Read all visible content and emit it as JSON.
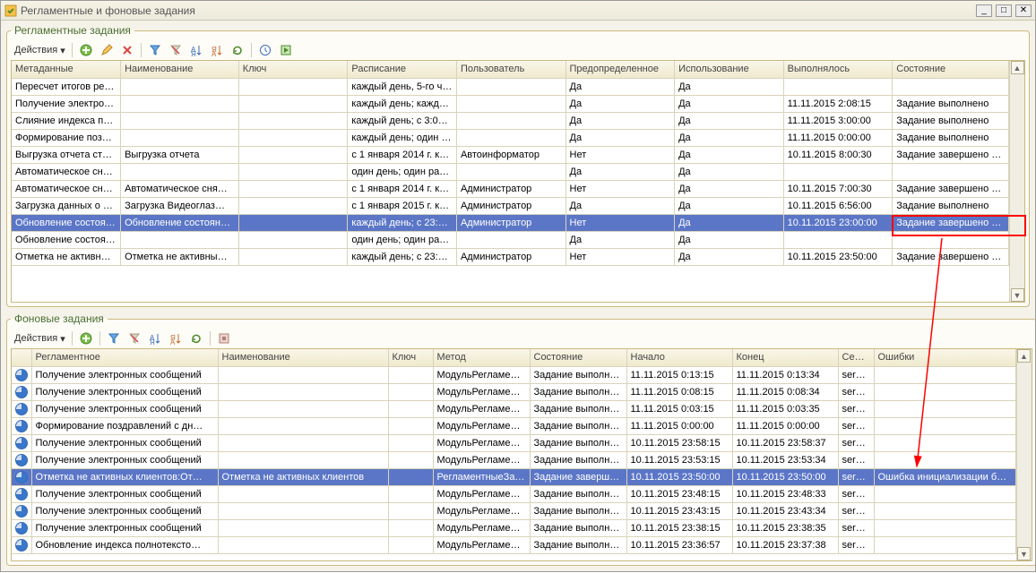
{
  "window": {
    "title": "Регламентные и фоновые задания"
  },
  "panel1": {
    "legend": "Регламентные задания",
    "actions_label": "Действия",
    "columns": [
      "Метаданные",
      "Наименование",
      "Ключ",
      "Расписание",
      "Пользователь",
      "Предопределенное",
      "Использование",
      "Выполнялось",
      "Состояние"
    ],
    "rows": [
      {
        "meta": "Пересчет итогов ре…",
        "name": "",
        "key": "",
        "sched": "каждый  день, 5-го ч…",
        "user": "",
        "pre": "Да",
        "use": "Да",
        "ran": "",
        "state": ""
      },
      {
        "meta": "Получение электро…",
        "name": "",
        "key": "",
        "sched": "каждый  день; кажд…",
        "user": "",
        "pre": "Да",
        "use": "Да",
        "ran": "11.11.2015 2:08:15",
        "state": "Задание выполнено"
      },
      {
        "meta": "Слияние индекса по…",
        "name": "",
        "key": "",
        "sched": "каждый  день; с 3:0…",
        "user": "",
        "pre": "Да",
        "use": "Да",
        "ran": "11.11.2015 3:00:00",
        "state": "Задание выполнено"
      },
      {
        "meta": "Формирование поз…",
        "name": "",
        "key": "",
        "sched": "каждый  день; один …",
        "user": "",
        "pre": "Да",
        "use": "Да",
        "ran": "11.11.2015 0:00:00",
        "state": "Задание выполнено"
      },
      {
        "meta": "Выгрузка отчета ст…",
        "name": "Выгрузка отчета",
        "key": "",
        "sched": "с 1 января 2014 г. к…",
        "user": "Автоинформатор",
        "pre": "Нет",
        "use": "Да",
        "ran": "10.11.2015 8:00:30",
        "state": "Задание завершено …"
      },
      {
        "meta": "Автоматическое сн…",
        "name": "",
        "key": "",
        "sched": "один день; один раз…",
        "user": "",
        "pre": "Да",
        "use": "Да",
        "ran": "",
        "state": ""
      },
      {
        "meta": "Автоматическое сн…",
        "name": "Автоматическое сня…",
        "key": "",
        "sched": "с 1 января 2014 г. к…",
        "user": "Администратор",
        "pre": "Нет",
        "use": "Да",
        "ran": "10.11.2015 7:00:30",
        "state": "Задание завершено …"
      },
      {
        "meta": "Загрузка данных о …",
        "name": "Загрузка Видеоглаз…",
        "key": "",
        "sched": "с 1 января 2015 г. к…",
        "user": "Администратор",
        "pre": "Да",
        "use": "Да",
        "ran": "10.11.2015 6:56:00",
        "state": "Задание выполнено"
      },
      {
        "meta": "Обновление состоя…",
        "name": "Обновление состоян…",
        "key": "",
        "sched": "каждый  день; с 23:…",
        "user": "Администратор",
        "pre": "Нет",
        "use": "Да",
        "ran": "10.11.2015 23:00:00",
        "state": "Задание завершено …",
        "selected": true
      },
      {
        "meta": "Обновление состоя…",
        "name": "",
        "key": "",
        "sched": "один день; один раз…",
        "user": "",
        "pre": "Да",
        "use": "Да",
        "ran": "",
        "state": ""
      },
      {
        "meta": "Отметка не активн…",
        "name": "Отметка не активны…",
        "key": "",
        "sched": "каждый  день; с 23:…",
        "user": "Администратор",
        "pre": "Нет",
        "use": "Да",
        "ran": "10.11.2015 23:50:00",
        "state": "Задание завершено …"
      }
    ]
  },
  "panel2": {
    "legend": "Фоновые задания",
    "actions_label": "Действия",
    "columns": [
      "",
      "Регламентное",
      "Наименование",
      "Ключ",
      "Метод",
      "Состояние",
      "Начало",
      "Конец",
      "Сер…",
      "Ошибки"
    ],
    "rows": [
      {
        "reg": "Получение электронных сообщений",
        "name": "",
        "key": "",
        "method": "МодульРегламен…",
        "state": "Задание выполне…",
        "start": "11.11.2015 0:13:15",
        "end": "11.11.2015 0:13:34",
        "srv": "serv…",
        "err": ""
      },
      {
        "reg": "Получение электронных сообщений",
        "name": "",
        "key": "",
        "method": "МодульРегламен…",
        "state": "Задание выполне…",
        "start": "11.11.2015 0:08:15",
        "end": "11.11.2015 0:08:34",
        "srv": "serv…",
        "err": ""
      },
      {
        "reg": "Получение электронных сообщений",
        "name": "",
        "key": "",
        "method": "МодульРегламен…",
        "state": "Задание выполне…",
        "start": "11.11.2015 0:03:15",
        "end": "11.11.2015 0:03:35",
        "srv": "serv…",
        "err": ""
      },
      {
        "reg": "Формирование поздравлений с дн…",
        "name": "",
        "key": "",
        "method": "МодульРегламен…",
        "state": "Задание выполне…",
        "start": "11.11.2015 0:00:00",
        "end": "11.11.2015 0:00:00",
        "srv": "serv…",
        "err": ""
      },
      {
        "reg": "Получение электронных сообщений",
        "name": "",
        "key": "",
        "method": "МодульРегламен…",
        "state": "Задание выполне…",
        "start": "10.11.2015 23:58:15",
        "end": "10.11.2015 23:58:37",
        "srv": "serv…",
        "err": ""
      },
      {
        "reg": "Получение электронных сообщений",
        "name": "",
        "key": "",
        "method": "МодульРегламен…",
        "state": "Задание выполне…",
        "start": "10.11.2015 23:53:15",
        "end": "10.11.2015 23:53:34",
        "srv": "serv…",
        "err": ""
      },
      {
        "reg": "Отметка не активных клиентов:От…",
        "name": "Отметка не активных клиентов",
        "key": "",
        "method": "РегламентныеЗа…",
        "state": "Задание заверш…",
        "start": "10.11.2015 23:50:00",
        "end": "10.11.2015 23:50:00",
        "srv": "serv…",
        "err": "Ошибка инициализации библи…",
        "selected": true
      },
      {
        "reg": "Получение электронных сообщений",
        "name": "",
        "key": "",
        "method": "МодульРегламен…",
        "state": "Задание выполне…",
        "start": "10.11.2015 23:48:15",
        "end": "10.11.2015 23:48:33",
        "srv": "serv…",
        "err": ""
      },
      {
        "reg": "Получение электронных сообщений",
        "name": "",
        "key": "",
        "method": "МодульРегламен…",
        "state": "Задание выполне…",
        "start": "10.11.2015 23:43:15",
        "end": "10.11.2015 23:43:34",
        "srv": "serv…",
        "err": ""
      },
      {
        "reg": "Получение электронных сообщений",
        "name": "",
        "key": "",
        "method": "МодульРегламен…",
        "state": "Задание выполне…",
        "start": "10.11.2015 23:38:15",
        "end": "10.11.2015 23:38:35",
        "srv": "serv…",
        "err": ""
      },
      {
        "reg": "Обновление индекса полнотексто…",
        "name": "",
        "key": "",
        "method": "МодульРегламен…",
        "state": "Задание выполне…",
        "start": "10.11.2015 23:36:57",
        "end": "10.11.2015 23:37:38",
        "srv": "serv…",
        "err": ""
      }
    ]
  }
}
